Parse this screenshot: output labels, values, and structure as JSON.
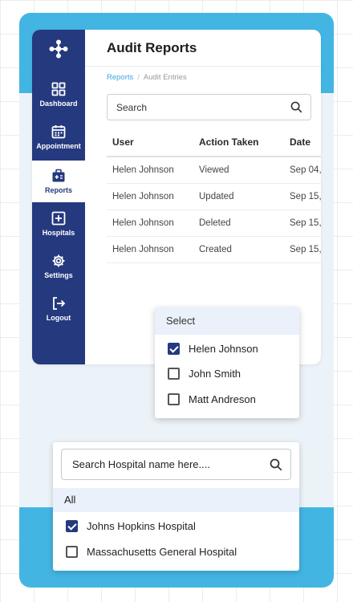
{
  "sidebar": {
    "items": [
      {
        "label": "Dashboard",
        "icon": "dashboard-icon",
        "active": false
      },
      {
        "label": "Appointment",
        "icon": "calendar-icon",
        "active": false
      },
      {
        "label": "Reports",
        "icon": "reports-icon",
        "active": true
      },
      {
        "label": "Hospitals",
        "icon": "hospital-icon",
        "active": false
      },
      {
        "label": "Settings",
        "icon": "gear-icon",
        "active": false
      },
      {
        "label": "Logout",
        "icon": "logout-icon",
        "active": false
      }
    ]
  },
  "page": {
    "title": "Audit Reports",
    "breadcrumb": {
      "parent": "Reports",
      "current": "Audit Entries"
    }
  },
  "search": {
    "placeholder": "Search"
  },
  "table": {
    "headers": {
      "user": "User",
      "action": "Action Taken",
      "date": "Date"
    },
    "rows": [
      {
        "user": "Helen Johnson",
        "action": "Viewed",
        "date": "Sep 04,"
      },
      {
        "user": "Helen Johnson",
        "action": "Updated",
        "date": "Sep 15,"
      },
      {
        "user": "Helen Johnson",
        "action": "Deleted",
        "date": "Sep 15,"
      },
      {
        "user": "Helen Johnson",
        "action": "Created",
        "date": "Sep 15,"
      }
    ]
  },
  "user_filter": {
    "header": "Select",
    "options": [
      {
        "label": "Helen Johnson",
        "checked": true
      },
      {
        "label": "John Smith",
        "checked": false
      },
      {
        "label": "Matt Andreson",
        "checked": false
      }
    ]
  },
  "hospital_filter": {
    "placeholder": "Search Hospital name here....",
    "all_label": "All",
    "options": [
      {
        "label": "Johns Hopkins Hospital",
        "checked": true
      },
      {
        "label": "Massachusetts General Hospital",
        "checked": false
      }
    ]
  },
  "colors": {
    "sidebar": "#25397f",
    "accent_band": "#43b5e3",
    "breadcrumb_link": "#3aa8de",
    "dropdown_header": "#eaf1fb"
  }
}
